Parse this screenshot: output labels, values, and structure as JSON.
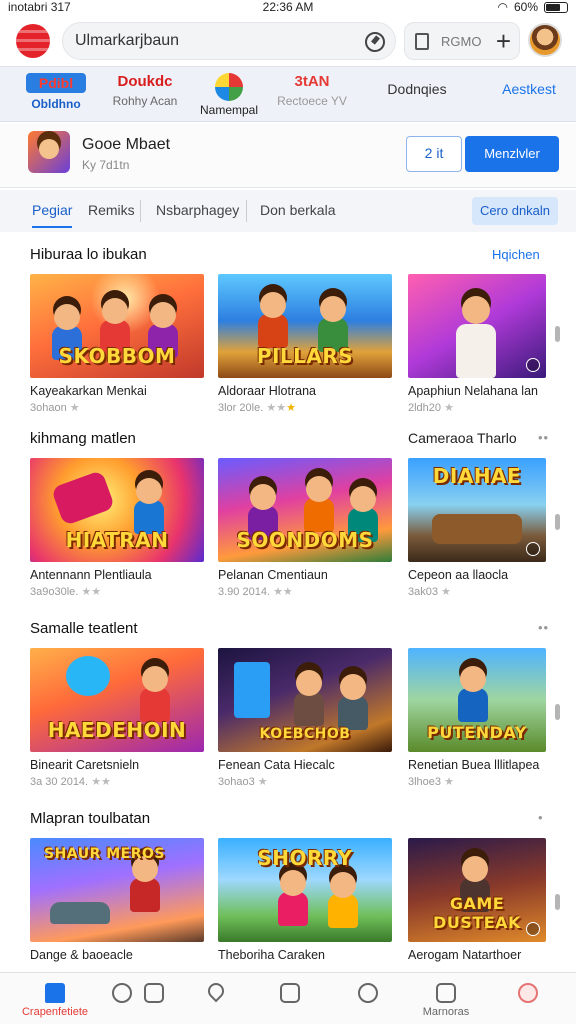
{
  "status_bar": {
    "carrier": "inotabri 317",
    "time": "22:36 AM",
    "battery": "60%"
  },
  "header": {
    "search_value": "Ulmarkarjbaun",
    "cart_label": "RGMO",
    "add_label": "+"
  },
  "categories": [
    {
      "big": "Pdibl",
      "small": "Obldhno"
    },
    {
      "big": "Doukdc",
      "small": "Rohhy Acan"
    },
    {
      "big": "",
      "small": "Namempal"
    },
    {
      "big": "3tAN",
      "small": "Rectoece YV"
    },
    {
      "big": "Dodnqies",
      "small": ""
    },
    {
      "big": "Aestkest",
      "small": ""
    }
  ],
  "featured": {
    "title": "Gooe Mbaet",
    "subtitle": "Ky 7d1tn",
    "secondary_button": "2 it",
    "primary_button": "Menzlvler"
  },
  "tabs": {
    "items": [
      "Pegiar",
      "Remiks",
      "Nsbarphagey",
      "Don berkala"
    ],
    "pill": "Cero dnkaln"
  },
  "sections": [
    {
      "title": "Hiburaa lo ibukan",
      "link": "Hqichen",
      "cards": [
        {
          "name": "Kayeakarkan Menkai",
          "meta": "3ohaon",
          "rating": 1,
          "art": "SKOBBOM"
        },
        {
          "name": "Aldoraar Hlotrana",
          "meta": "3lor 20le.",
          "rating": 3,
          "art": "PILLARS"
        },
        {
          "name": "Apaphiun Nelahana lan",
          "meta": "2ldh20",
          "rating": 1,
          "art": ""
        }
      ]
    },
    {
      "title": "kihmang matlen",
      "right": "Cameraoa Tharlo",
      "cards": [
        {
          "name": "Antennann Plentliaula",
          "meta": "3a9o30le.",
          "rating": 2,
          "art": "HIATRAN"
        },
        {
          "name": "Pelanan Cmentiaun",
          "meta": "3.90 2014.",
          "rating": 2,
          "art": "SOONDOMS"
        },
        {
          "name": "Cepeon aa llaocla",
          "meta": "3ak03",
          "rating": 1,
          "art": "DIAHAE"
        }
      ]
    },
    {
      "title": "Samalle teatlent",
      "cards": [
        {
          "name": "Binearit Caretsnieln",
          "meta": "3a 30 2014.",
          "rating": 2,
          "art": "HAEDEHOIN"
        },
        {
          "name": "Fenean Cata Hiecalc",
          "meta": "3ohao3",
          "rating": 1,
          "art": "KOEBCHOB"
        },
        {
          "name": "Renetian Buea lllitlapea",
          "meta": "3lhoe3",
          "rating": 1,
          "art": "PUTENDAY"
        }
      ]
    },
    {
      "title": "Mlapran toulbatan",
      "cards": [
        {
          "name": "Dange & baoeacle",
          "meta": "",
          "rating": 0,
          "art": "SHAUR MEROS"
        },
        {
          "name": "Theboriha Caraken",
          "meta": "",
          "rating": 0,
          "art": "SHORRY"
        },
        {
          "name": "Aerogam Natarthoer",
          "meta": "",
          "rating": 0,
          "art": "GAME DUSTEAK"
        }
      ]
    }
  ],
  "bottom_nav": [
    {
      "label": "Crapenfetiete",
      "icon": "home-icon"
    },
    {
      "label": "",
      "icon": "search-icon"
    },
    {
      "label": "",
      "icon": "library-icon"
    },
    {
      "label": "",
      "icon": "heart-icon"
    },
    {
      "label": "",
      "icon": "bank-icon"
    },
    {
      "label": "",
      "icon": "search-icon"
    },
    {
      "label": "Marnoras",
      "icon": "chart-icon"
    },
    {
      "label": "",
      "icon": "profile-icon"
    }
  ],
  "colors": {
    "accent": "#1a73e8",
    "brand_red": "#e4222a"
  }
}
